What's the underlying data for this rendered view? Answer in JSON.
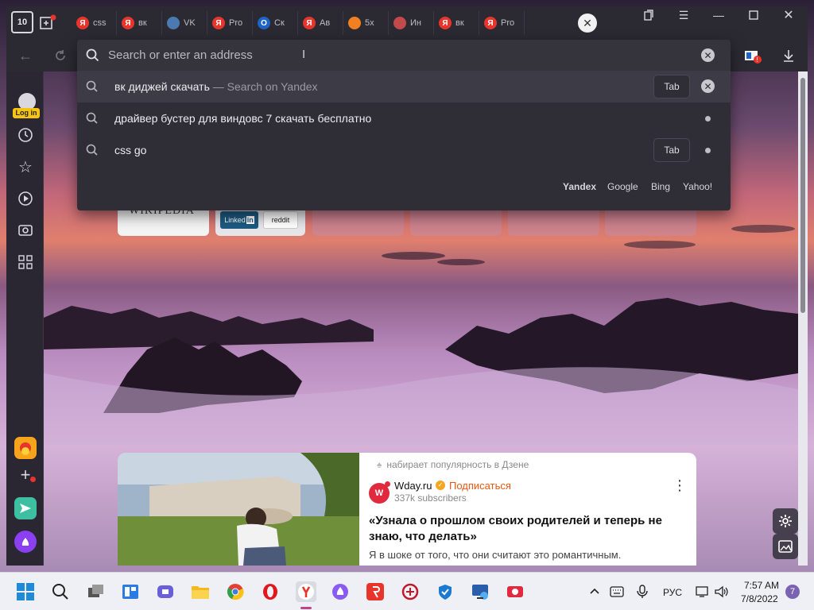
{
  "browser": {
    "tabs": [
      {
        "label": "css",
        "fav": "Я",
        "color": "#e7352b"
      },
      {
        "label": "вк",
        "fav": "Я",
        "color": "#e7352b"
      },
      {
        "label": "VK",
        "fav": "",
        "color": "#4a7ab0"
      },
      {
        "label": "Pro",
        "fav": "Я",
        "color": "#e7352b"
      },
      {
        "label": "Ск",
        "fav": "O",
        "color": "#1e63c6"
      },
      {
        "label": "Ав",
        "fav": "Я",
        "color": "#e7352b"
      },
      {
        "label": "5x",
        "fav": "",
        "color": "#f38020"
      },
      {
        "label": "Ин",
        "fav": "",
        "color": "#c24a4a"
      },
      {
        "label": "вк",
        "fav": "Я",
        "color": "#e7352b"
      },
      {
        "label": "Pro",
        "fav": "Я",
        "color": "#e7352b"
      }
    ],
    "tab_count": "10",
    "addressbar": {
      "placeholder": "Search or enter an address"
    },
    "suggestions": [
      {
        "query": "вк диджей скачать",
        "suffix": " — Search on Yandex",
        "tab_chip": "Tab",
        "highlighted": true
      },
      {
        "query": "драйвер бустер для виндовс 7 скачать бесплатно",
        "suffix": "",
        "tab_chip": "",
        "highlighted": false
      },
      {
        "query": "css go",
        "suffix": "",
        "tab_chip": "Tab",
        "highlighted": false
      }
    ],
    "engines": [
      "Yandex",
      "Google",
      "Bing",
      "Yahoo!"
    ],
    "sidebar": {
      "login_label": "Log in"
    },
    "speed_dial": {
      "wikipedia": "WIKIPEDIA",
      "linkedin": "Linked",
      "reddit": "reddit"
    }
  },
  "dzen_card": {
    "trending": "набирает популярность в Дзене",
    "source": "Wday.ru",
    "subscribe": "Подписаться",
    "subscribers": "337k subscribers",
    "headline": "«Узнала о прошлом своих родителей и теперь не знаю, что делать»",
    "snippet": "Я в шоке от того, что они считают это романтичным."
  },
  "taskbar": {
    "lang": "РУС",
    "time": "7:57 AM",
    "date": "7/8/2022",
    "notifications": "7"
  },
  "colors": {
    "accent_red": "#e7352b",
    "subscribe_orange": "#e8560e",
    "chrome_bg": "#2b2a33"
  }
}
